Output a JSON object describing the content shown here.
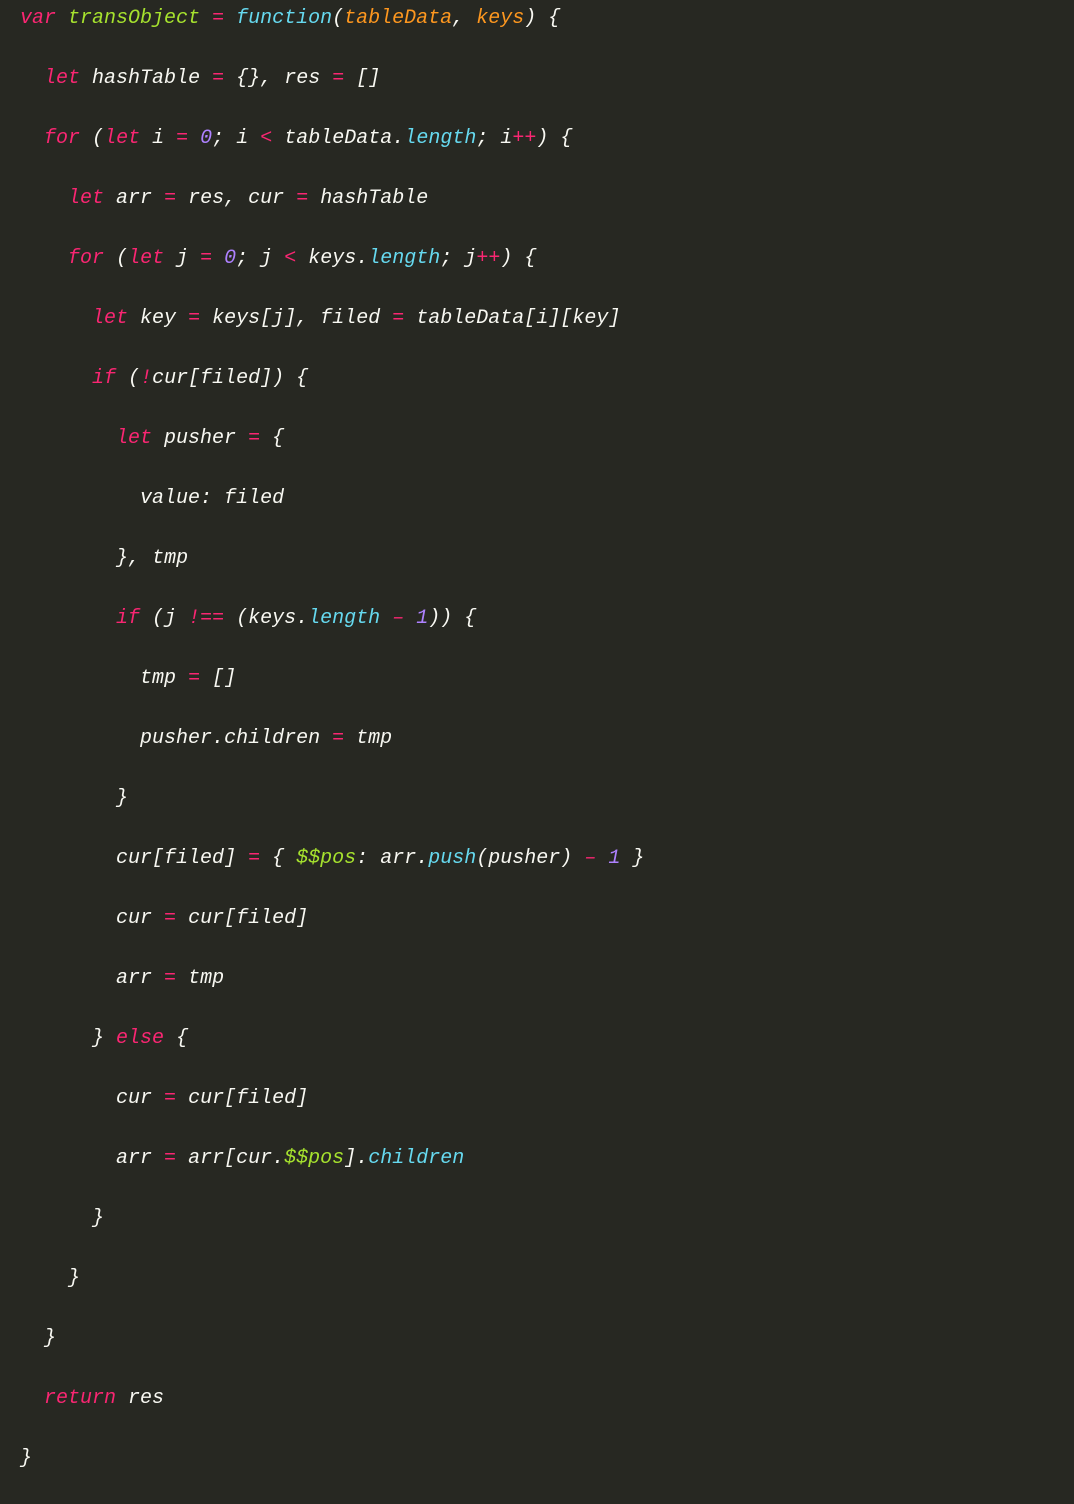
{
  "tokens": {
    "var": "var",
    "let": "let",
    "for": "for",
    "if": "if",
    "else": "else",
    "return": "return",
    "function": "function",
    "transObject": "transObject",
    "tableData": "tableData",
    "keys": "keys",
    "hashTable": "hashTable",
    "res": "res",
    "i": "i",
    "j": "j",
    "arr": "arr",
    "cur": "cur",
    "key": "key",
    "filed": "filed",
    "pusher": "pusher",
    "value": "value",
    "tmp": "tmp",
    "children": "children",
    "length": "length",
    "push": "push",
    "dpos": "$$pos",
    "zero": "0",
    "one": "1",
    "eq": "=",
    "lt": "<",
    "bang": "!",
    "neqq": "!==",
    "minus": "–",
    "plusplus": "++",
    "comma": ",",
    "dot": ".",
    "colon": ":",
    "semi": ";",
    "lparen": "(",
    "rparen": ")",
    "lbrace": "{",
    "rbrace": "}",
    "lbracket": "[",
    "rbracket": "]",
    "space": " "
  }
}
